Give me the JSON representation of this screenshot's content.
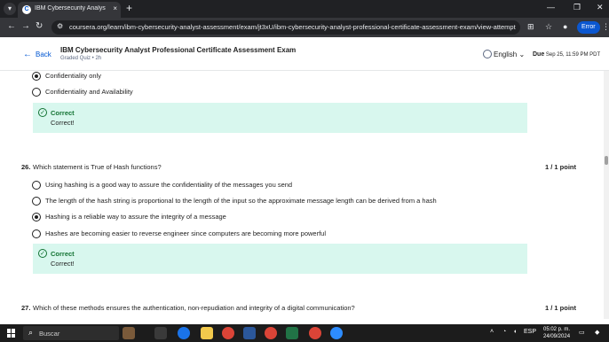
{
  "browser": {
    "tab_title": "IBM Cybersecurity Analyst Profe",
    "tab_close": "×",
    "new_tab": "+",
    "url": "coursera.org/learn/ibm-cybersecurity-analyst-assessment/exam/jt3xU/ibm-cybersecurity-analyst-professional-certificate-assessment-exam/view-attempt",
    "error_label": "Error",
    "icons": [
      "tab-search-icon",
      "back-icon",
      "forward-icon",
      "reload-icon",
      "site-info-icon",
      "translate-icon",
      "bookmark-icon",
      "profile-icon",
      "menu-icon"
    ]
  },
  "header": {
    "back_label": "Back",
    "title": "IBM Cybersecurity Analyst Professional Certificate Assessment Exam",
    "subtitle": "Graded Quiz • 2h",
    "language": "English",
    "due_label": "Due",
    "due_date": "Sep 25, 11:59 PM PDT"
  },
  "prev_question": {
    "options": [
      {
        "label": "Confidentiality only",
        "selected": true
      },
      {
        "label": "Confidentiality and Availability",
        "selected": false
      }
    ],
    "feedback_title": "Correct",
    "feedback_text": "Correct!"
  },
  "question26": {
    "number": "26.",
    "text": "Which statement is True of Hash functions?",
    "points": "1 / 1 point",
    "options": [
      {
        "label": "Using hashing is a good way to assure the confidentiality of the messages you send",
        "selected": false
      },
      {
        "label": "The length of the hash string is proportional to the length of the input so the approximate message length can be derived from a hash",
        "selected": false
      },
      {
        "label": "Hashing is a reliable way to assure the integrity of a message",
        "selected": true
      },
      {
        "label": "Hashes are becoming easier to reverse engineer since computers are becoming more powerful",
        "selected": false
      }
    ],
    "feedback_title": "Correct",
    "feedback_text": "Correct!"
  },
  "question27": {
    "number": "27.",
    "text": "Which of these methods ensures the authentication, non-repudiation and integrity of a digital communication?",
    "points": "1 / 1 point"
  },
  "taskbar": {
    "search_placeholder": "Buscar",
    "language": "ESP",
    "time": "05:02 p. m.",
    "date": "24/09/2024"
  },
  "colors": {
    "accent": "#0056d2",
    "correct_bg": "#d8f7ee",
    "correct_text": "#137333"
  }
}
